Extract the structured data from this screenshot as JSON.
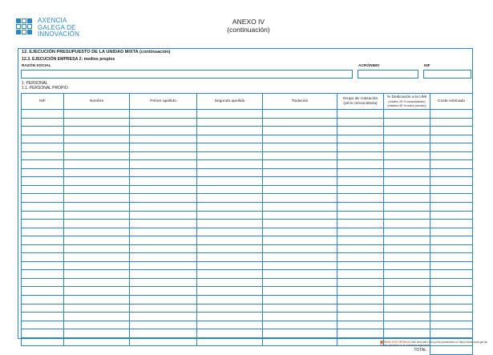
{
  "logo": {
    "lines": [
      "AXENCIA",
      "GALEGA DE",
      "INNOVACIÓN"
    ]
  },
  "header": {
    "annex": "ANEXO IV",
    "continuation": "(continuación)"
  },
  "section": {
    "title": "12. EJECUCIÓN PRESUPUESTO DE LA UNIDAD MIXTA (continuación)",
    "subtitle": "12.3. EJECUCIÓN EMPRESA 2: medios propios"
  },
  "company": {
    "razon_social_label": "RAZÓN SOCIAL",
    "razon_social_value": "",
    "acronimo_label": "ACRÓNIMO",
    "acronimo_value": "",
    "nif_label": "NIF",
    "nif_value": ""
  },
  "personal": {
    "heading": "1. PERSONAL",
    "subheading": "1.1. PERSONAL PROPIO"
  },
  "table": {
    "columns": [
      {
        "label": "NIF"
      },
      {
        "label": "Nombre"
      },
      {
        "label": "Primer apellido"
      },
      {
        "label": "Segundo apellido"
      },
      {
        "label": "Titulación"
      },
      {
        "label": "Grupo de cotización",
        "sub": "(art.6 convocatoria)"
      },
      {
        "label": "% Dedicación a la UMI",
        "sub": "(mínimo 25 % consolidación) (máximo 50 % nuevo servicio)"
      },
      {
        "label": "Coste estimado"
      }
    ],
    "row_count": 28,
    "total_label": "TOTAL",
    "total_value": ""
  },
  "footer": {
    "brand": "SEDE ELECTRÓNICA",
    "text": "Este formulario solo podrá presentarse en https://sede.xunta.gal  las formas previstas en la normativa reguladora"
  },
  "colors": {
    "accent": "#2e86c1",
    "footer_brand": "#e0703a"
  }
}
